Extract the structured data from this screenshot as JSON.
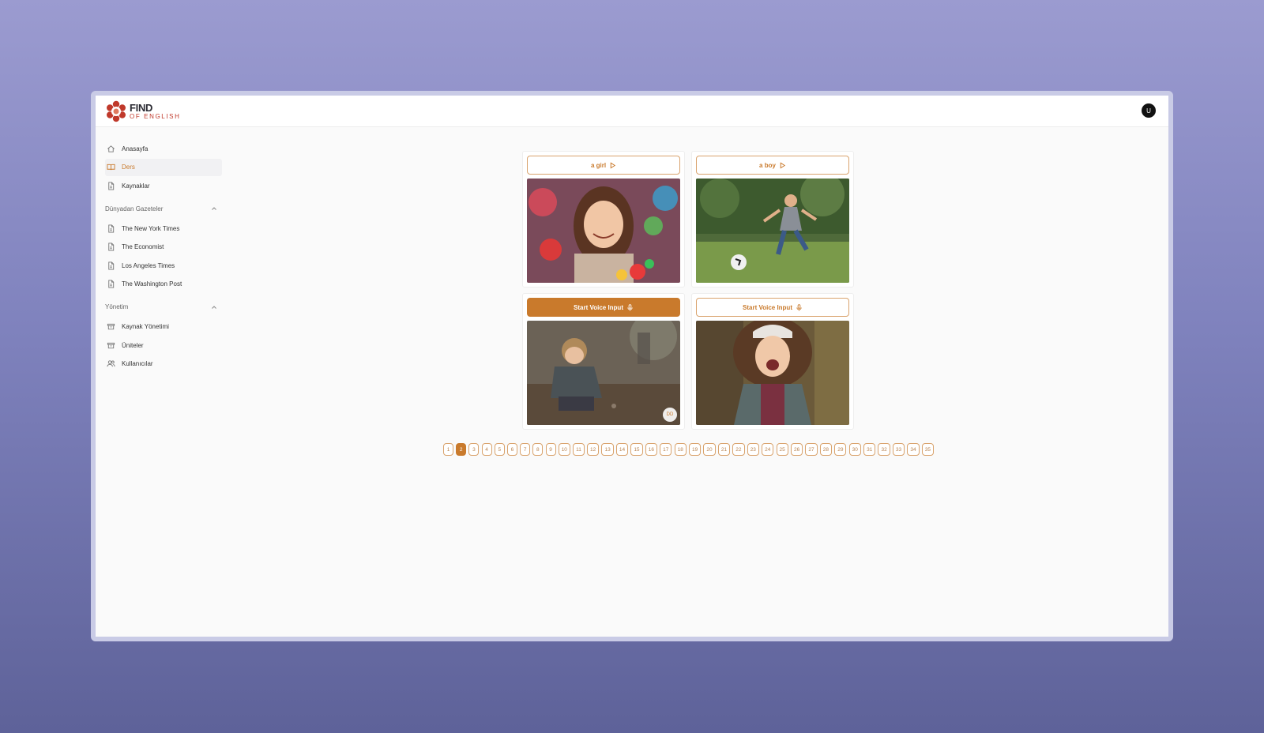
{
  "brand": {
    "name": "FIND",
    "sub": "OF ENGLISH"
  },
  "user": {
    "initial": "U"
  },
  "sidebar": {
    "main": [
      {
        "label": "Anasayfa",
        "icon": "home-icon"
      },
      {
        "label": "Ders",
        "icon": "book-icon",
        "active": true
      },
      {
        "label": "Kaynaklar",
        "icon": "file-icon"
      }
    ],
    "newspapers": {
      "title": "Dünyadan Gazeteler",
      "items": [
        "The New York Times",
        "The Economist",
        "Los Angeles Times",
        "The Washington Post"
      ]
    },
    "management": {
      "title": "Yönetim",
      "items": [
        "Kaynak Yönetimi",
        "Üniteler",
        "Kullanıcılar"
      ]
    }
  },
  "cards": [
    {
      "button": "a girl",
      "icon": "play-icon",
      "filled": false,
      "image": "girl-with-toys"
    },
    {
      "button": "a boy",
      "icon": "play-icon",
      "filled": false,
      "image": "boy-playing-soccer"
    },
    {
      "button": "Start Voice Input",
      "icon": "mic-icon",
      "filled": true,
      "image": "boy-crouching-outdoors",
      "badge": "DD"
    },
    {
      "button": "Start Voice Input",
      "icon": "mic-icon",
      "filled": false,
      "image": "girl-on-bike"
    }
  ],
  "pagination": {
    "pages": [
      "1",
      "2",
      "3",
      "4",
      "5",
      "6",
      "7",
      "8",
      "9",
      "10",
      "11",
      "12",
      "13",
      "14",
      "15",
      "16",
      "17",
      "18",
      "19",
      "20",
      "21",
      "22",
      "23",
      "24",
      "25",
      "26",
      "27",
      "28",
      "29",
      "30",
      "31",
      "32",
      "33",
      "34",
      "35"
    ],
    "current": "2"
  },
  "colors": {
    "accent": "#c97a2c",
    "brand_red": "#c0392b"
  }
}
